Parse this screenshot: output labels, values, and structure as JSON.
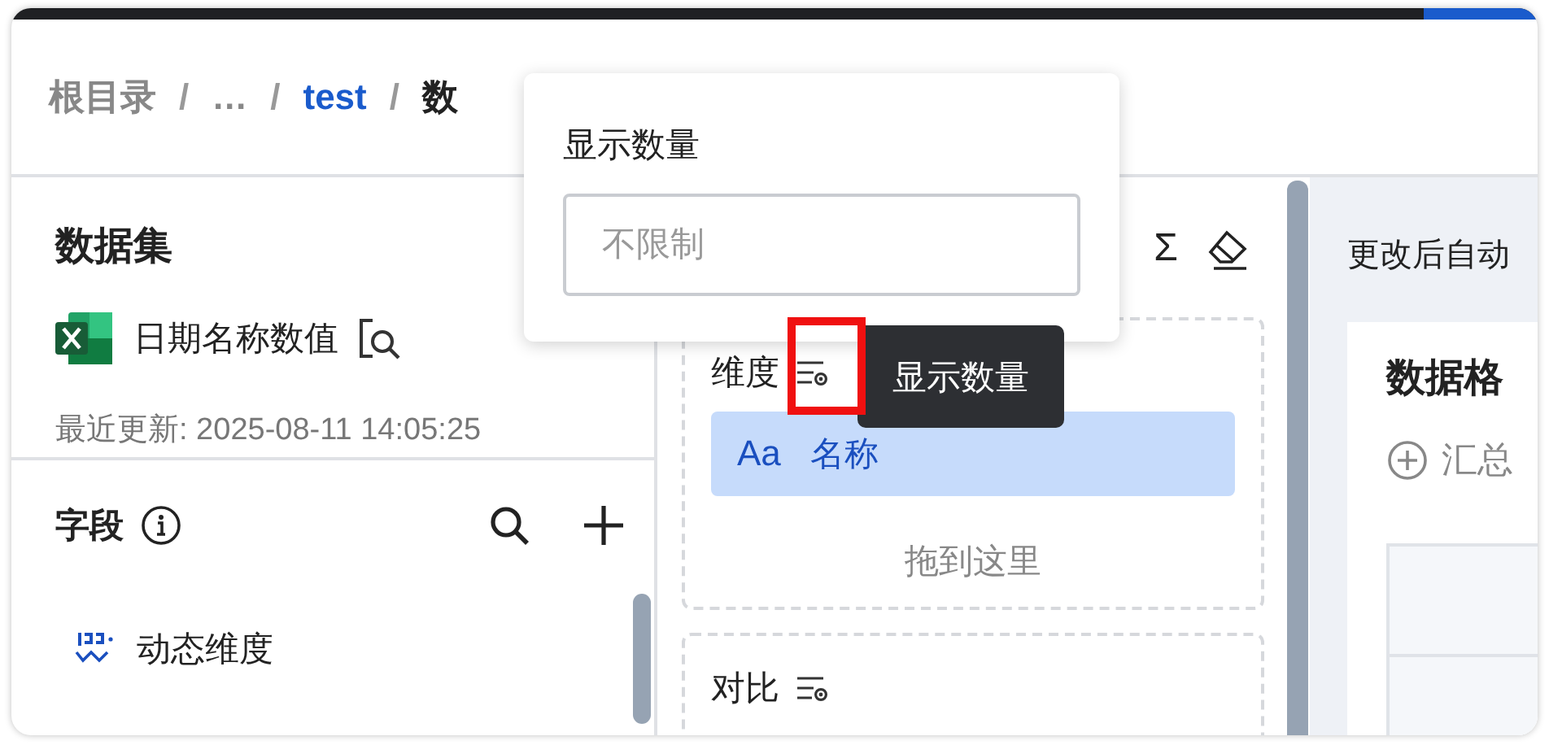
{
  "breadcrumb": [
    {
      "label": "根目录",
      "kind": "plain"
    },
    {
      "label": "/",
      "kind": "separator"
    },
    {
      "label": "…",
      "kind": "plain"
    },
    {
      "label": "/",
      "kind": "separator"
    },
    {
      "label": "test",
      "kind": "link"
    },
    {
      "label": "/",
      "kind": "separator"
    },
    {
      "label": "数",
      "kind": "current"
    }
  ],
  "dataset": {
    "title": "数据集",
    "name": "日期名称数值",
    "updated": "最近更新: 2025-08-11 14:05:25"
  },
  "fields": {
    "title": "字段",
    "items": [
      {
        "label": "动态维度",
        "kind": "dynamic"
      }
    ]
  },
  "toolbar": {
    "sum_symbol": "Σ"
  },
  "dimension": {
    "title": "维度",
    "chips": [
      {
        "type_label": "Aa",
        "label": "名称"
      }
    ],
    "drop_hint": "拖到这里"
  },
  "compare": {
    "title": "对比"
  },
  "right": {
    "note": "更改后自动",
    "card_title": "数据格",
    "add_label": "汇总"
  },
  "popover": {
    "title": "显示数量",
    "placeholder": "不限制"
  },
  "tooltip": "显示数量"
}
